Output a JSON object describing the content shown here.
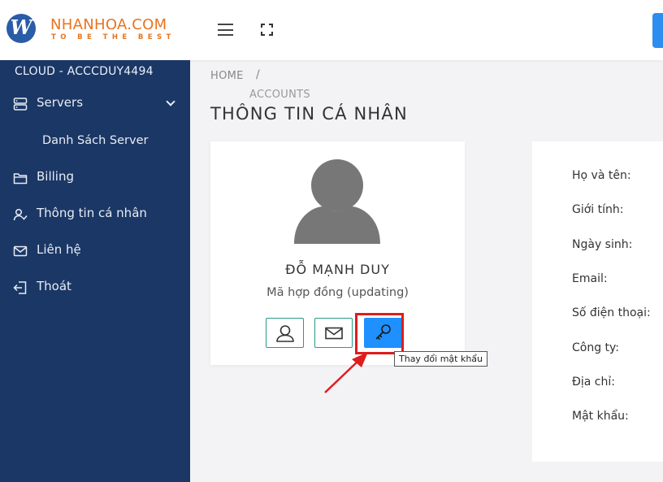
{
  "header": {
    "logo_letter": "W",
    "brand_name": "NHANHOA.COM",
    "brand_tagline": "TO BE THE BEST"
  },
  "sidebar": {
    "account_title": "CLOUD - ACCCDUY4494",
    "items": [
      {
        "label": "Servers",
        "icon": "server-icon"
      },
      {
        "label": "Danh Sách Server"
      },
      {
        "label": "Billing",
        "icon": "folder-icon"
      },
      {
        "label": "Thông tin cá nhân",
        "icon": "user-check-icon"
      },
      {
        "label": "Liên hệ",
        "icon": "mail-icon"
      },
      {
        "label": "Thoát",
        "icon": "logout-icon"
      }
    ]
  },
  "breadcrumb": {
    "home": "HOME",
    "separator": "/",
    "current": "ACCOUNTS"
  },
  "page_title": "THÔNG TIN CÁ NHÂN",
  "profile": {
    "name": "ĐỖ MẠNH DUY",
    "contract": "Mã hợp đồng (updating)",
    "tooltip": "Thay đổi mật khẩu"
  },
  "info_labels": [
    "Họ và tên:",
    "Giới tính:",
    "Ngày sinh:",
    "Email:",
    "Số điện thoại:",
    "Công ty:",
    "Địa chỉ:",
    "Mật khẩu:"
  ],
  "colors": {
    "sidebar_bg": "#1b3765",
    "brand_orange": "#e8741e",
    "accent_blue": "#1e90ff",
    "button_border": "#2a9a8a",
    "annotation_red": "#e01c1c"
  }
}
